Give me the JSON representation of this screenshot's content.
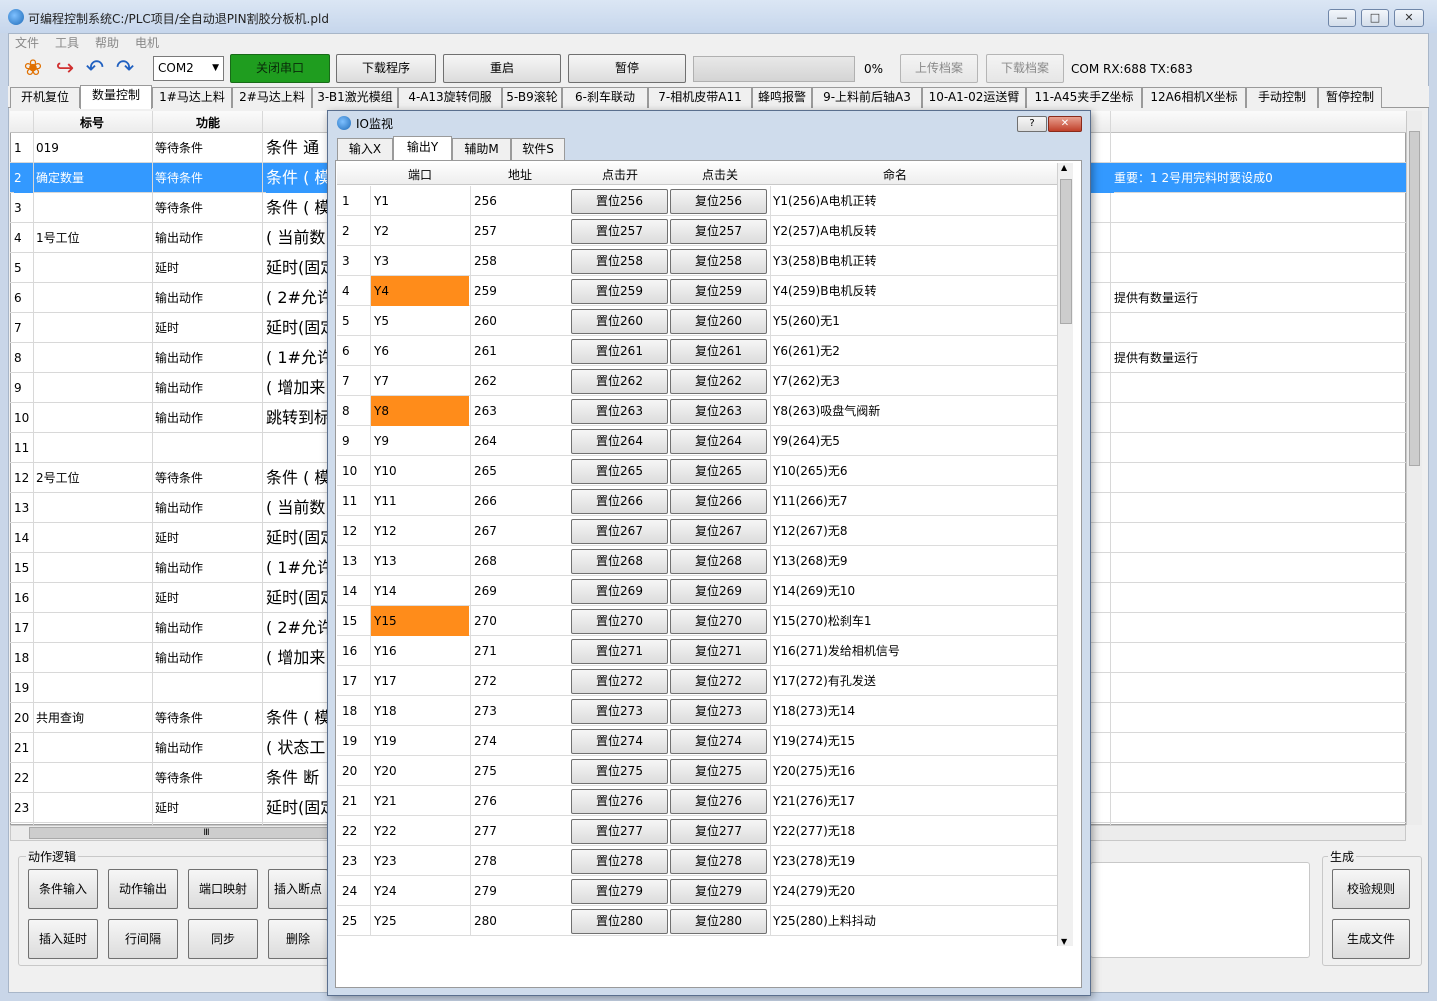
{
  "window": {
    "title": "可编程控制系统C:/PLC项目/全自动退PIN割胶分板机.pld",
    "min_label": "▭",
    "max_label": "□",
    "close_label": "✕"
  },
  "menu": [
    "文件",
    "工具",
    "帮助",
    "电机"
  ],
  "toolbar": {
    "port_value": "COM2",
    "close_port": "关闭串口",
    "download": "下载程序",
    "restart": "重启",
    "pause": "暂停",
    "progress_value": "0%",
    "upload_archive": "上传档案",
    "download_archive": "下载档案",
    "com_status": "COM RX:688 TX:683"
  },
  "tabs": [
    "开机复位",
    "数量控制",
    "1#马达上料",
    "2#马达上料",
    "3-B1激光模组",
    "4-A13旋转伺服",
    "5-B9滚轮",
    "6-刹车联动",
    "7-相机皮带A11",
    "蜂鸣报警",
    "9-上料前后轴A3",
    "10-A1-02运送臂",
    "11-A45夹手Z坐标",
    "12A6相机X坐标",
    "手动控制",
    "暂停控制"
  ],
  "grid": {
    "headers": {
      "label": "标号",
      "func": "功能"
    },
    "rows": [
      {
        "n": "1",
        "label": "019",
        "func": "等待条件",
        "expr": "条件 通",
        "note": ""
      },
      {
        "n": "2",
        "label": "确定数量",
        "func": "等待条件",
        "expr": "条件 ( 模",
        "note": "重要：1 2号用完料时要设成0"
      },
      {
        "n": "3",
        "label": "",
        "func": "等待条件",
        "expr": "条件 ( 模",
        "note": ""
      },
      {
        "n": "4",
        "label": "1号工位",
        "func": "输出动作",
        "expr": "( 当前数",
        "note": ""
      },
      {
        "n": "5",
        "label": "",
        "func": "延时",
        "expr": "延时(固定(",
        "note": ""
      },
      {
        "n": "6",
        "label": "",
        "func": "输出动作",
        "expr": "( 2#允许",
        "note": "提供有数量运行"
      },
      {
        "n": "7",
        "label": "",
        "func": "延时",
        "expr": "延时(固定(",
        "note": ""
      },
      {
        "n": "8",
        "label": "",
        "func": "输出动作",
        "expr": "( 1#允许",
        "note": "提供有数量运行"
      },
      {
        "n": "9",
        "label": "",
        "func": "输出动作",
        "expr": "( 增加来",
        "note": ""
      },
      {
        "n": "10",
        "label": "",
        "func": "输出动作",
        "expr": "跳转到标",
        "note": ""
      },
      {
        "n": "11",
        "label": "",
        "func": "",
        "expr": "",
        "note": ""
      },
      {
        "n": "12",
        "label": "2号工位",
        "func": "等待条件",
        "expr": "条件 ( 模",
        "note": ""
      },
      {
        "n": "13",
        "label": "",
        "func": "输出动作",
        "expr": "( 当前数",
        "note": ""
      },
      {
        "n": "14",
        "label": "",
        "func": "延时",
        "expr": "延时(固定(",
        "note": ""
      },
      {
        "n": "15",
        "label": "",
        "func": "输出动作",
        "expr": "( 1#允许",
        "note": ""
      },
      {
        "n": "16",
        "label": "",
        "func": "延时",
        "expr": "延时(固定(",
        "note": ""
      },
      {
        "n": "17",
        "label": "",
        "func": "输出动作",
        "expr": "( 2#允许",
        "note": ""
      },
      {
        "n": "18",
        "label": "",
        "func": "输出动作",
        "expr": "( 增加来",
        "note": ""
      },
      {
        "n": "19",
        "label": "",
        "func": "",
        "expr": "",
        "note": ""
      },
      {
        "n": "20",
        "label": "共用查询",
        "func": "等待条件",
        "expr": "条件 ( 模",
        "note": ""
      },
      {
        "n": "21",
        "label": "",
        "func": "输出动作",
        "expr": "( 状态工",
        "note": ""
      },
      {
        "n": "22",
        "label": "",
        "func": "等待条件",
        "expr": "条件 断",
        "note": ""
      },
      {
        "n": "23",
        "label": "",
        "func": "延时",
        "expr": "延时(固定(",
        "note": ""
      }
    ],
    "hscroll_grip": "Ⅲ"
  },
  "action_logic": {
    "title": "动作逻辑",
    "buttons_row1": [
      "条件输入",
      "动作输出",
      "端口映射",
      "插入断点"
    ],
    "buttons_row2": [
      "插入延时",
      "行间隔",
      "同步",
      "删除"
    ]
  },
  "generate": {
    "title": "生成",
    "verify": "校验规则",
    "gen_file": "生成文件"
  },
  "io_dialog": {
    "title": "IO监视",
    "help_label": "?",
    "close_label": "✕",
    "tabs": [
      "输入X",
      "输出Y",
      "辅助M",
      "软件S"
    ],
    "headers": {
      "port": "端口",
      "addr": "地址",
      "on": "点击开",
      "off": "点击关",
      "name": "命名"
    },
    "rows": [
      {
        "n": "1",
        "port": "Y1",
        "addr": "256",
        "on": "置位256",
        "off": "复位256",
        "name": "Y1(256)A电机正转",
        "active": false
      },
      {
        "n": "2",
        "port": "Y2",
        "addr": "257",
        "on": "置位257",
        "off": "复位257",
        "name": "Y2(257)A电机反转",
        "active": false
      },
      {
        "n": "3",
        "port": "Y3",
        "addr": "258",
        "on": "置位258",
        "off": "复位258",
        "name": "Y3(258)B电机正转",
        "active": false
      },
      {
        "n": "4",
        "port": "Y4",
        "addr": "259",
        "on": "置位259",
        "off": "复位259",
        "name": "Y4(259)B电机反转",
        "active": true
      },
      {
        "n": "5",
        "port": "Y5",
        "addr": "260",
        "on": "置位260",
        "off": "复位260",
        "name": "Y5(260)无1",
        "active": false
      },
      {
        "n": "6",
        "port": "Y6",
        "addr": "261",
        "on": "置位261",
        "off": "复位261",
        "name": "Y6(261)无2",
        "active": false
      },
      {
        "n": "7",
        "port": "Y7",
        "addr": "262",
        "on": "置位262",
        "off": "复位262",
        "name": "Y7(262)无3",
        "active": false
      },
      {
        "n": "8",
        "port": "Y8",
        "addr": "263",
        "on": "置位263",
        "off": "复位263",
        "name": "Y8(263)吸盘气阀新",
        "active": true
      },
      {
        "n": "9",
        "port": "Y9",
        "addr": "264",
        "on": "置位264",
        "off": "复位264",
        "name": "Y9(264)无5",
        "active": false
      },
      {
        "n": "10",
        "port": "Y10",
        "addr": "265",
        "on": "置位265",
        "off": "复位265",
        "name": "Y10(265)无6",
        "active": false
      },
      {
        "n": "11",
        "port": "Y11",
        "addr": "266",
        "on": "置位266",
        "off": "复位266",
        "name": "Y11(266)无7",
        "active": false
      },
      {
        "n": "12",
        "port": "Y12",
        "addr": "267",
        "on": "置位267",
        "off": "复位267",
        "name": "Y12(267)无8",
        "active": false
      },
      {
        "n": "13",
        "port": "Y13",
        "addr": "268",
        "on": "置位268",
        "off": "复位268",
        "name": "Y13(268)无9",
        "active": false
      },
      {
        "n": "14",
        "port": "Y14",
        "addr": "269",
        "on": "置位269",
        "off": "复位269",
        "name": "Y14(269)无10",
        "active": false
      },
      {
        "n": "15",
        "port": "Y15",
        "addr": "270",
        "on": "置位270",
        "off": "复位270",
        "name": "Y15(270)松刹车1",
        "active": true
      },
      {
        "n": "16",
        "port": "Y16",
        "addr": "271",
        "on": "置位271",
        "off": "复位271",
        "name": "Y16(271)发给相机信号",
        "active": false
      },
      {
        "n": "17",
        "port": "Y17",
        "addr": "272",
        "on": "置位272",
        "off": "复位272",
        "name": "Y17(272)有孔发送",
        "active": false
      },
      {
        "n": "18",
        "port": "Y18",
        "addr": "273",
        "on": "置位273",
        "off": "复位273",
        "name": "Y18(273)无14",
        "active": false
      },
      {
        "n": "19",
        "port": "Y19",
        "addr": "274",
        "on": "置位274",
        "off": "复位274",
        "name": "Y19(274)无15",
        "active": false
      },
      {
        "n": "20",
        "port": "Y20",
        "addr": "275",
        "on": "置位275",
        "off": "复位275",
        "name": "Y20(275)无16",
        "active": false
      },
      {
        "n": "21",
        "port": "Y21",
        "addr": "276",
        "on": "置位276",
        "off": "复位276",
        "name": "Y21(276)无17",
        "active": false
      },
      {
        "n": "22",
        "port": "Y22",
        "addr": "277",
        "on": "置位277",
        "off": "复位277",
        "name": "Y22(277)无18",
        "active": false
      },
      {
        "n": "23",
        "port": "Y23",
        "addr": "278",
        "on": "置位278",
        "off": "复位278",
        "name": "Y23(278)无19",
        "active": false
      },
      {
        "n": "24",
        "port": "Y24",
        "addr": "279",
        "on": "置位279",
        "off": "复位279",
        "name": "Y24(279)无20",
        "active": false
      },
      {
        "n": "25",
        "port": "Y25",
        "addr": "280",
        "on": "置位280",
        "off": "复位280",
        "name": "Y25(280)上料抖动",
        "active": false
      }
    ],
    "active_color": "#ff8c1a"
  },
  "colors": {
    "selection": "#3399ff",
    "close_port_bg": "#1f9d1f"
  }
}
